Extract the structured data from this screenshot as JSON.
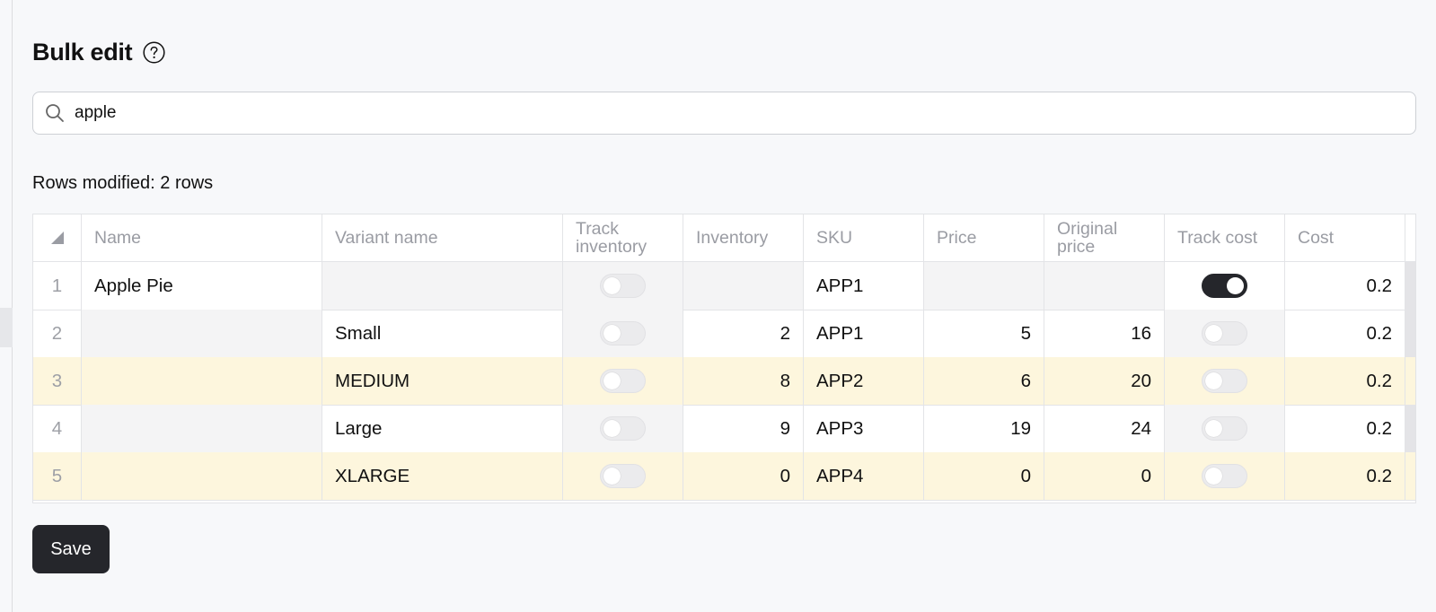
{
  "page": {
    "title": "Bulk edit",
    "help_icon": "question-circle-icon",
    "accent_color": "#25262b",
    "modified_row_color": "#fdf6dd"
  },
  "search": {
    "icon": "search-icon",
    "value": "apple",
    "placeholder": ""
  },
  "status": {
    "rows_modified": "Rows modified: 2 rows"
  },
  "table": {
    "columns": [
      "Name",
      "Variant name",
      "Track inventory",
      "Inventory",
      "SKU",
      "Price",
      "Original price",
      "Track cost",
      "Cost"
    ],
    "rows": [
      {
        "index": "1",
        "name": "Apple Pie",
        "variant": "",
        "track_inventory": false,
        "inventory": "",
        "sku": "APP1",
        "price": "",
        "original_price": "",
        "track_cost": true,
        "cost": "0.2",
        "modified": false
      },
      {
        "index": "2",
        "name": "",
        "variant": "Small",
        "track_inventory": false,
        "inventory": "2",
        "sku": "APP1",
        "price": "5",
        "original_price": "16",
        "track_cost": false,
        "cost": "0.2",
        "modified": false
      },
      {
        "index": "3",
        "name": "",
        "variant": "MEDIUM",
        "track_inventory": false,
        "inventory": "8",
        "sku": "APP2",
        "price": "6",
        "original_price": "20",
        "track_cost": false,
        "cost": "0.2",
        "modified": true
      },
      {
        "index": "4",
        "name": "",
        "variant": "Large",
        "track_inventory": false,
        "inventory": "9",
        "sku": "APP3",
        "price": "19",
        "original_price": "24",
        "track_cost": false,
        "cost": "0.2",
        "modified": false
      },
      {
        "index": "5",
        "name": "",
        "variant": "XLARGE",
        "track_inventory": false,
        "inventory": "0",
        "sku": "APP4",
        "price": "0",
        "original_price": "0",
        "track_cost": false,
        "cost": "0.2",
        "modified": true
      }
    ]
  },
  "actions": {
    "save_label": "Save"
  }
}
